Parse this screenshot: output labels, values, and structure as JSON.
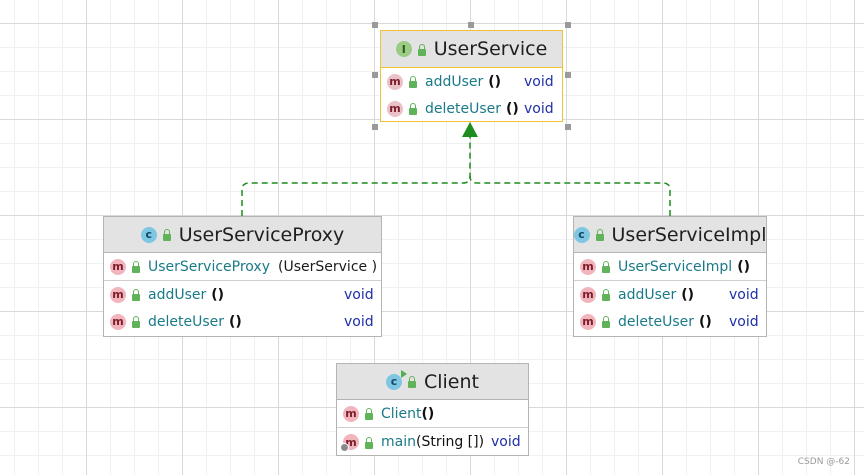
{
  "colors": {
    "inherit_arrow": "#1e8c1e",
    "selected_border": "#f1c232",
    "method_name": "#1a7a88",
    "return_type": "#1f2fa8",
    "header_bg": "#e3e3e3"
  },
  "userService": {
    "icon": "interface-icon",
    "icon_glyph": "I",
    "title": "UserService",
    "methods": [
      {
        "name": "addUser",
        "paren": "()",
        "type": "void"
      },
      {
        "name": "deleteUser",
        "paren": "()",
        "type": "void"
      }
    ]
  },
  "userServiceProxy": {
    "icon": "class-icon",
    "icon_glyph": "c",
    "title": "UserServiceProxy",
    "constructor": {
      "name": "UserServiceProxy",
      "params": "(UserService )"
    },
    "methods": [
      {
        "name": "addUser",
        "paren": "()",
        "type": "void"
      },
      {
        "name": "deleteUser",
        "paren": "()",
        "type": "void"
      }
    ]
  },
  "userServiceImpl": {
    "icon": "class-icon",
    "icon_glyph": "c",
    "title": "UserServiceImpl",
    "constructor": {
      "name": "UserServiceImpl",
      "paren": "()"
    },
    "methods": [
      {
        "name": "addUser",
        "paren": "()",
        "type": "void"
      },
      {
        "name": "deleteUser",
        "paren": "()",
        "type": "void"
      }
    ]
  },
  "client": {
    "icon": "runnable-class-icon",
    "icon_glyph": "c",
    "title": "Client",
    "constructor": {
      "name": "Client",
      "paren": "()"
    },
    "main": {
      "name": "main",
      "params": "(String [])",
      "type": "void"
    }
  },
  "method_glyph": "m",
  "watermark": "CSDN @-62"
}
